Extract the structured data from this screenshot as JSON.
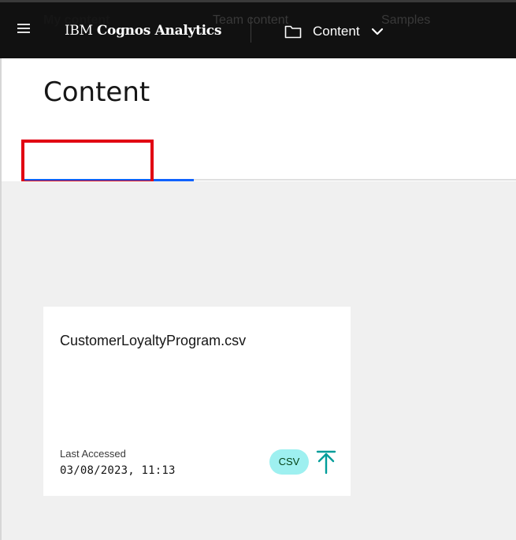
{
  "header": {
    "brand_prefix": "IBM",
    "brand_name": "Cognos Analytics",
    "switch_label": "Content",
    "icons": [
      "hamburger-icon",
      "folder-icon",
      "chevron-down-icon"
    ]
  },
  "page": {
    "title": "Content"
  },
  "tabs": [
    {
      "label": "My content",
      "active": true
    },
    {
      "label": "Team content",
      "active": false
    },
    {
      "label": "Samples",
      "active": false
    }
  ],
  "card": {
    "title": "CustomerLoyaltyProgram.csv",
    "last_accessed_label": "Last Accessed",
    "last_accessed_value": "03/08/2023, 11:13",
    "type_badge": "CSV",
    "action_icon": "upload-icon"
  },
  "colors": {
    "header_bg": "#111111",
    "active_tab_line": "#0f62fe",
    "highlight": "#e10012",
    "badge_bg": "#9ef0f0",
    "upload_icon": "#009d9a",
    "canvas": "#f0f0f0"
  }
}
